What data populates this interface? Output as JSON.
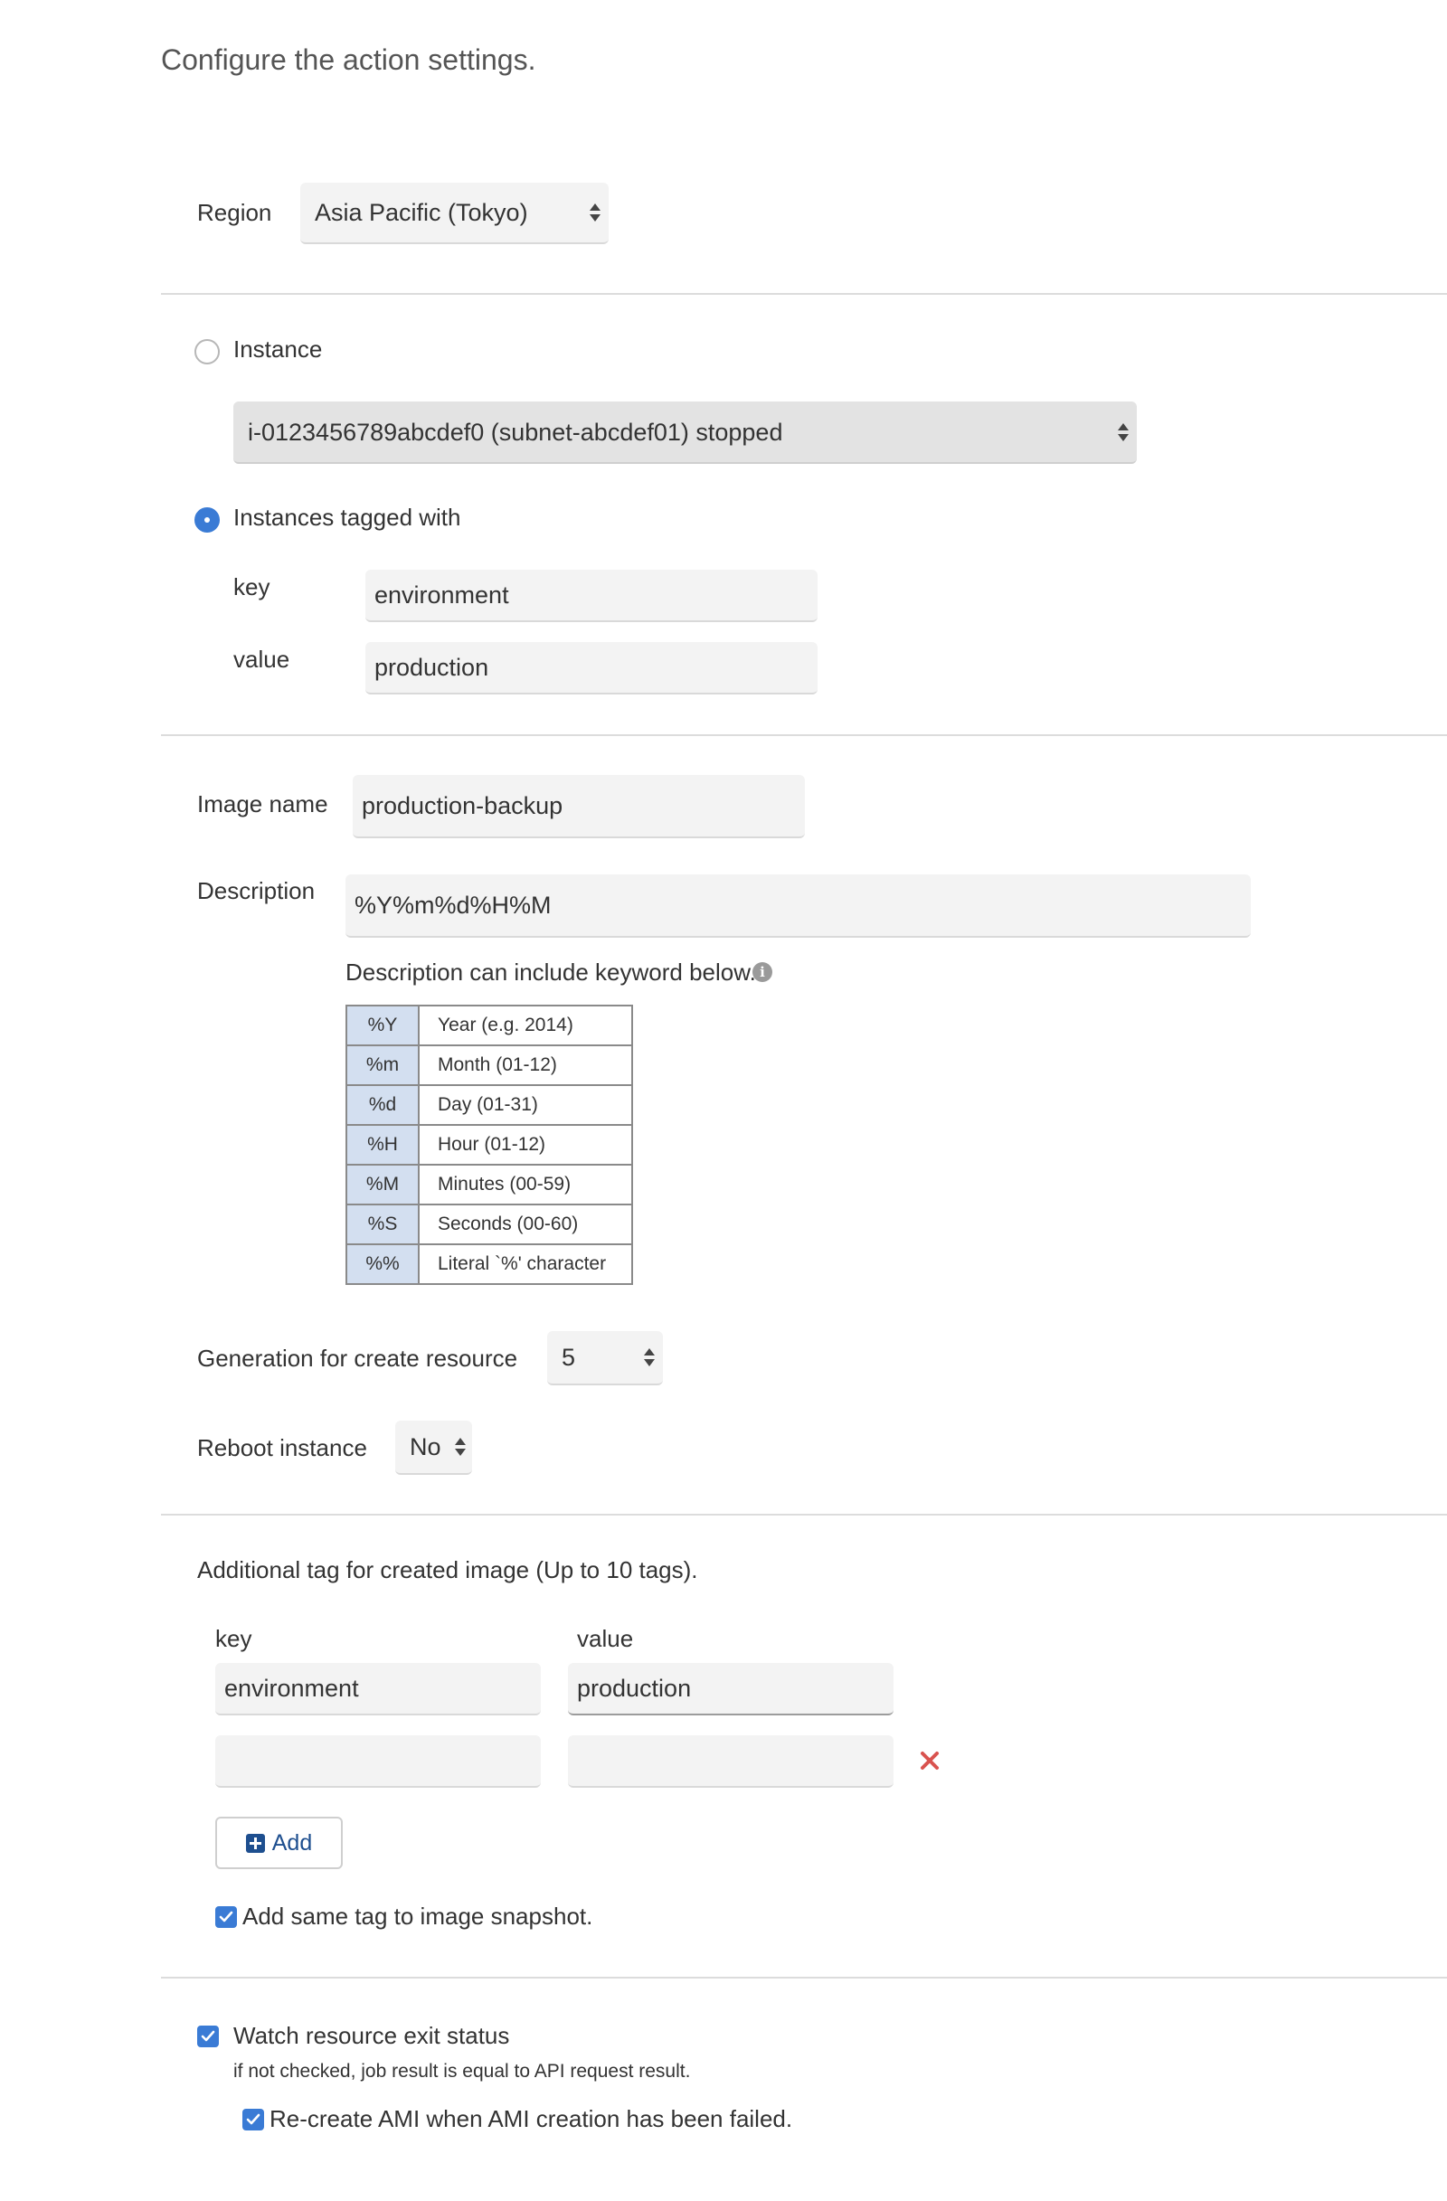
{
  "header": {
    "title": "Configure the action settings."
  },
  "region": {
    "label": "Region",
    "value": "Asia Pacific (Tokyo)"
  },
  "target": {
    "instance_label": "Instance",
    "instance_selected": false,
    "instance_value": "i-0123456789abcdef0 (subnet-abcdef01) stopped",
    "tagged_label": "Instances tagged with",
    "tagged_selected": true,
    "key_label": "key",
    "key_value": "environment",
    "value_label": "value",
    "value_value": "production"
  },
  "image": {
    "name_label": "Image name",
    "name_value": "production-backup",
    "description_label": "Description",
    "description_value": "%Y%m%d%H%M",
    "keyword_hint": "Description can include keyword below.",
    "keywords": [
      {
        "key": "%Y",
        "desc": "Year (e.g. 2014)"
      },
      {
        "key": "%m",
        "desc": "Month (01-12)"
      },
      {
        "key": "%d",
        "desc": "Day (01-31)"
      },
      {
        "key": "%H",
        "desc": "Hour (01-12)"
      },
      {
        "key": "%M",
        "desc": "Minutes (00-59)"
      },
      {
        "key": "%S",
        "desc": "Seconds (00-60)"
      },
      {
        "key": "%%",
        "desc": "Literal `%' character"
      }
    ]
  },
  "generation": {
    "label": "Generation for create resource",
    "value": "5"
  },
  "reboot": {
    "label": "Reboot instance",
    "value": "No"
  },
  "tags": {
    "heading": "Additional tag for created image (Up to 10 tags).",
    "key_header": "key",
    "value_header": "value",
    "rows": [
      {
        "key": "environment",
        "value": "production"
      },
      {
        "key": "",
        "value": ""
      }
    ],
    "add_label": "Add",
    "snapshot_label": "Add same tag to image snapshot.",
    "snapshot_checked": true
  },
  "watch": {
    "label": "Watch resource exit status",
    "checked": true,
    "hint": "if not checked, job result is equal to API request result.",
    "recreate_label": "Re-create AMI when AMI creation has been failed.",
    "recreate_checked": true
  },
  "colors": {
    "accent": "#3a7bd5",
    "link": "#1e4f8f",
    "remove": "#d9534f"
  }
}
